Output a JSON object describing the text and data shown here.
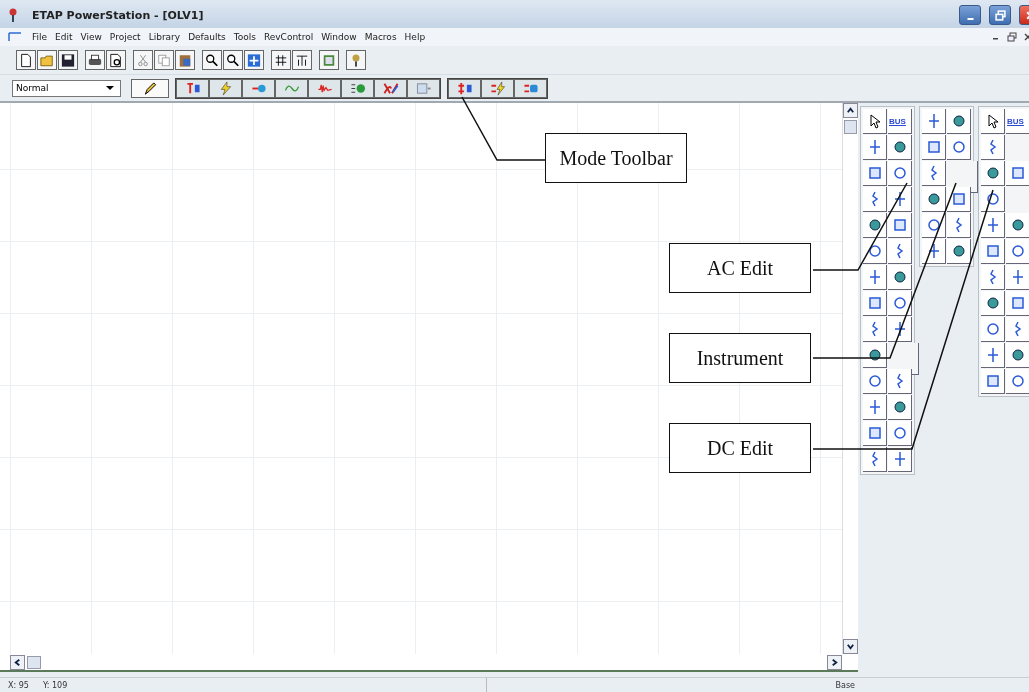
{
  "window": {
    "title": "ETAP PowerStation - [OLV1]"
  },
  "menu": [
    "File",
    "Edit",
    "View",
    "Project",
    "Library",
    "Defaults",
    "Tools",
    "RevControl",
    "Window",
    "Macros",
    "Help"
  ],
  "mode_toolbar": {
    "mode_select": "Normal"
  },
  "ac_palette": {
    "bus_label": "BUS"
  },
  "dc_palette": {
    "bus_label": "BUS"
  },
  "callouts": [
    {
      "text": "Mode Toolbar"
    },
    {
      "text": "AC Edit"
    },
    {
      "text": "Instrument"
    },
    {
      "text": "DC Edit"
    }
  ],
  "status_bar": {
    "x": "X: 95",
    "y": "Y: 109",
    "mode": "Base"
  }
}
